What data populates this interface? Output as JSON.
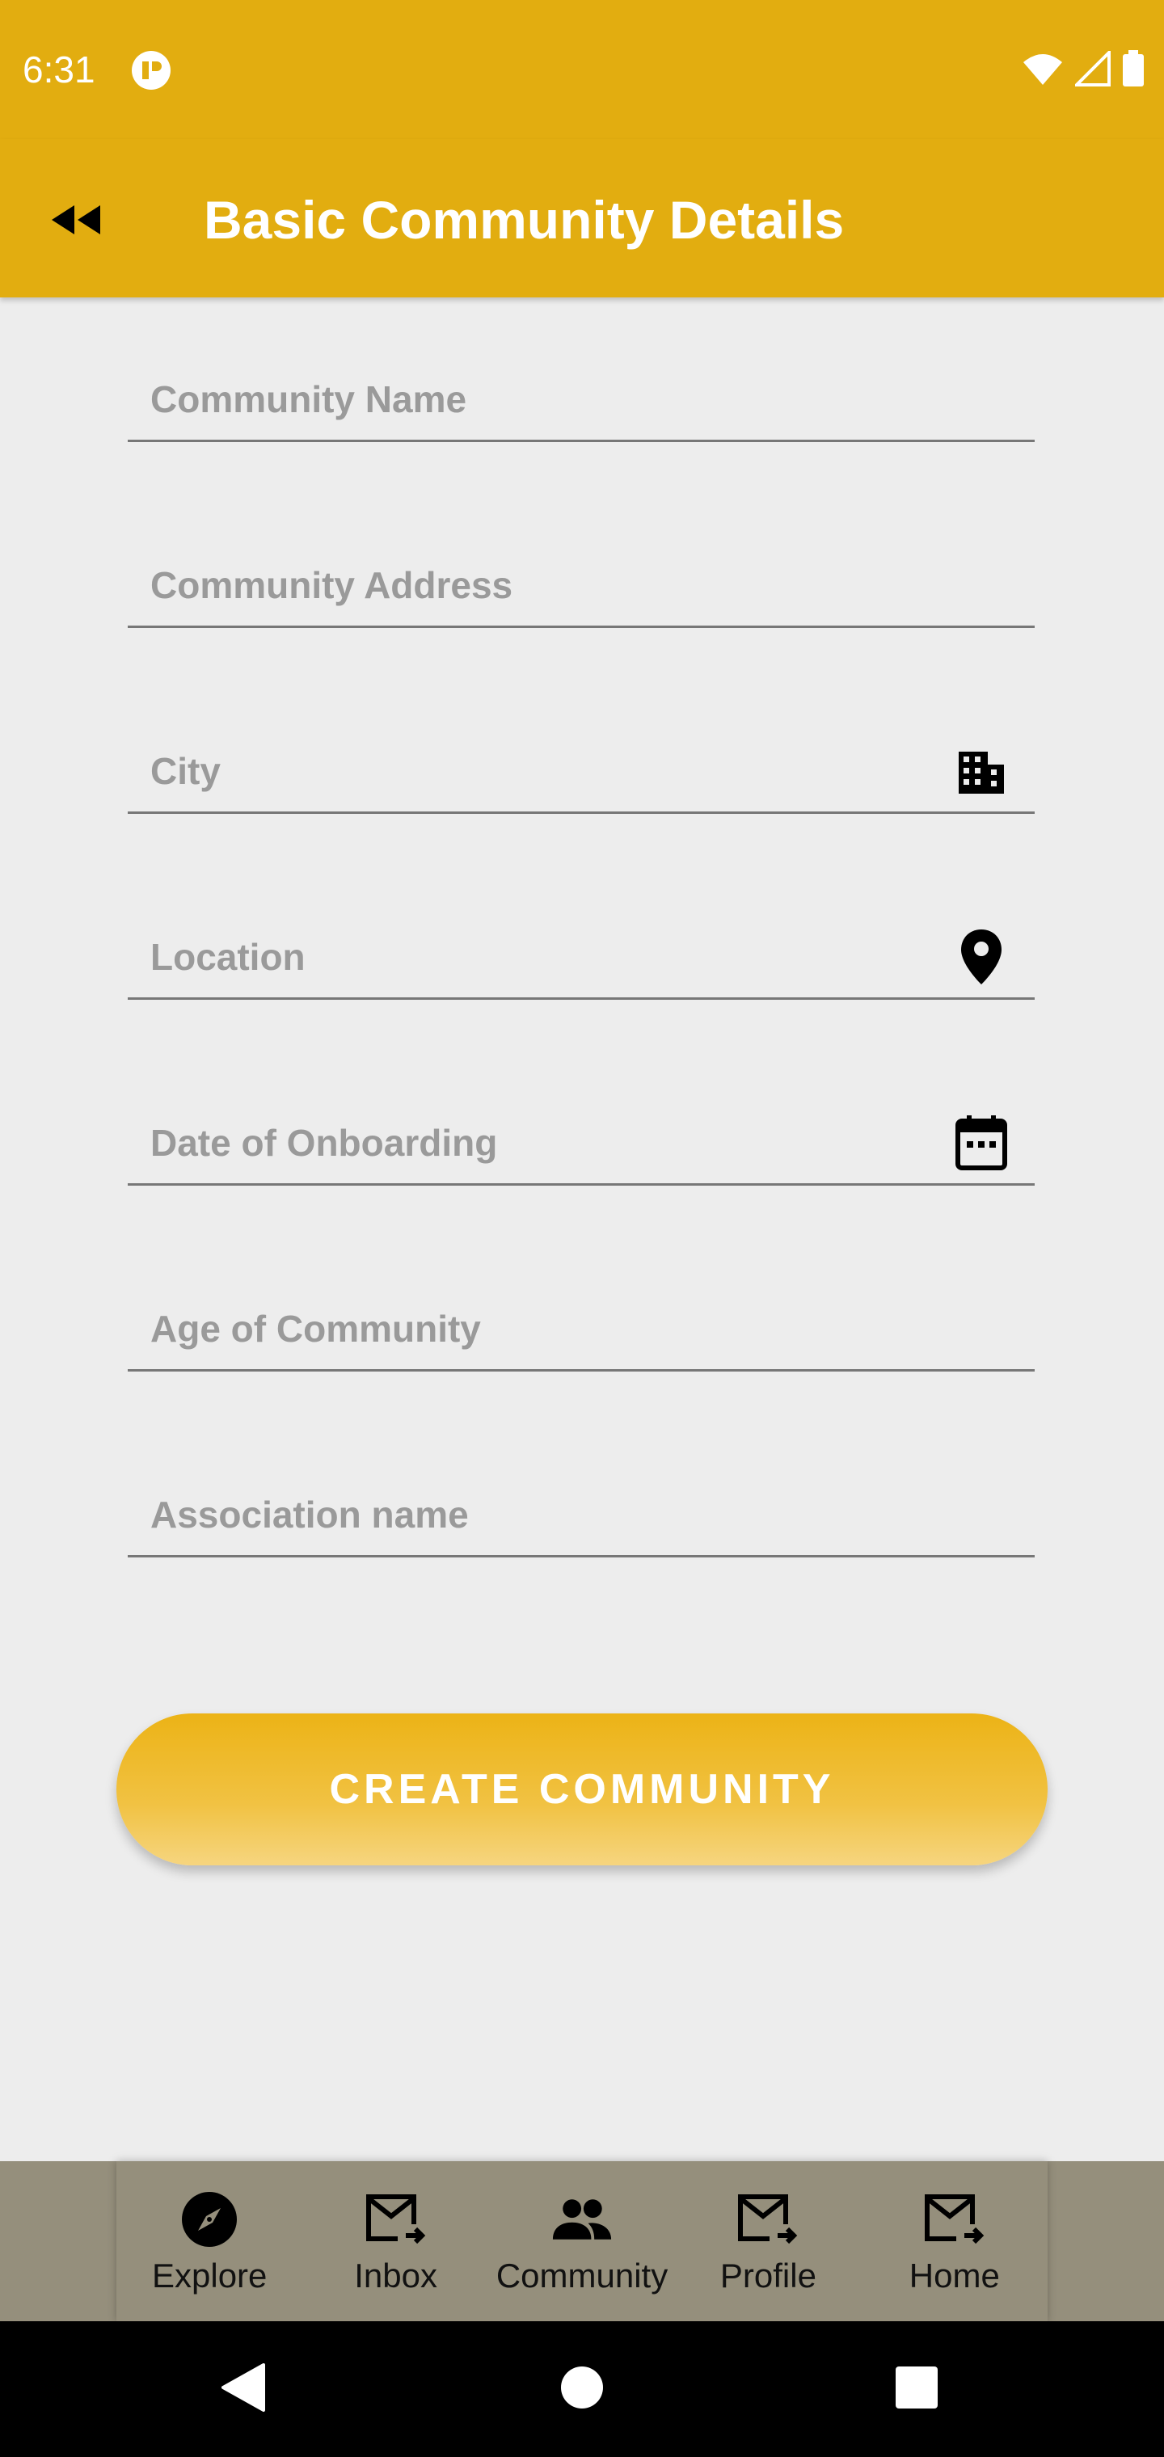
{
  "status_bar": {
    "time": "6:31",
    "icons": [
      "app-notification-icon",
      "wifi-icon",
      "signal-icon",
      "battery-icon"
    ]
  },
  "app_bar": {
    "title": "Basic Community Details",
    "back_icon": "fast-rewind-icon"
  },
  "form": {
    "fields": [
      {
        "placeholder": "Community Name",
        "value": "",
        "icon": ""
      },
      {
        "placeholder": "Community Address",
        "value": "",
        "icon": ""
      },
      {
        "placeholder": "City",
        "value": "",
        "icon": "building-icon"
      },
      {
        "placeholder": "Location",
        "value": "",
        "icon": "location-pin-icon"
      },
      {
        "placeholder": "Date of Onboarding",
        "value": "",
        "icon": "calendar-icon"
      },
      {
        "placeholder": "Age of Community",
        "value": "",
        "icon": ""
      },
      {
        "placeholder": "Association name",
        "value": "",
        "icon": ""
      }
    ],
    "submit_label": "CREATE COMMUNITY"
  },
  "bottom_nav": {
    "items": [
      {
        "label": "Explore",
        "icon": "compass-icon"
      },
      {
        "label": "Inbox",
        "icon": "mail-forward-icon"
      },
      {
        "label": "Community",
        "icon": "people-icon"
      },
      {
        "label": "Profile",
        "icon": "mail-forward-icon"
      },
      {
        "label": "Home",
        "icon": "mail-forward-icon"
      }
    ]
  },
  "colors": {
    "primary": "#e2ad10",
    "background": "#ededed",
    "nav_background": "#958f7c",
    "button_gradient_top": "#ecb316",
    "button_gradient_bottom": "#f6d57f"
  }
}
